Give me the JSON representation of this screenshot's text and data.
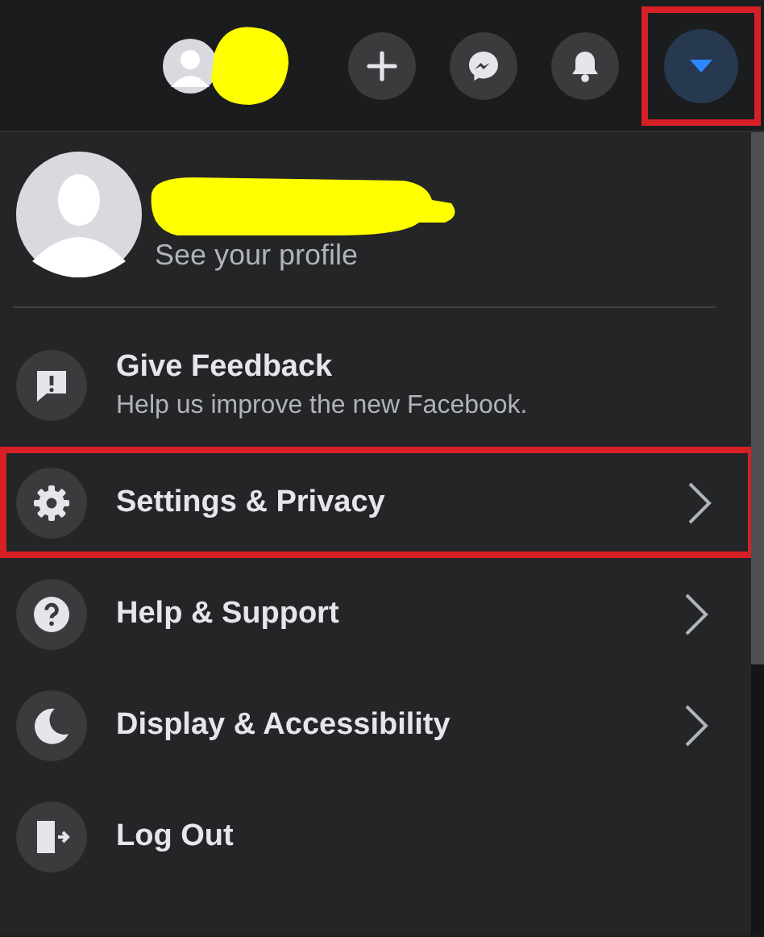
{
  "top_bar": {
    "buttons": [
      {
        "kind": "avatar",
        "highlighted": false
      },
      {
        "kind": "create",
        "highlighted": false
      },
      {
        "kind": "messenger",
        "highlighted": false
      },
      {
        "kind": "notifications",
        "highlighted": false
      },
      {
        "kind": "account",
        "highlighted": true,
        "selected": true
      }
    ]
  },
  "menu": {
    "profile": {
      "subtitle": "See your profile"
    },
    "items": [
      {
        "kind": "feedback",
        "title": "Give Feedback",
        "subtitle": "Help us improve the new Facebook.",
        "submenu": false,
        "highlighted": false
      },
      {
        "kind": "settings",
        "title": "Settings & Privacy",
        "submenu": true,
        "highlighted": true
      },
      {
        "kind": "help",
        "title": "Help & Support",
        "submenu": true,
        "highlighted": false
      },
      {
        "kind": "display",
        "title": "Display & Accessibility",
        "submenu": true,
        "highlighted": false
      },
      {
        "kind": "logout",
        "title": "Log Out",
        "submenu": false,
        "highlighted": false
      }
    ]
  }
}
